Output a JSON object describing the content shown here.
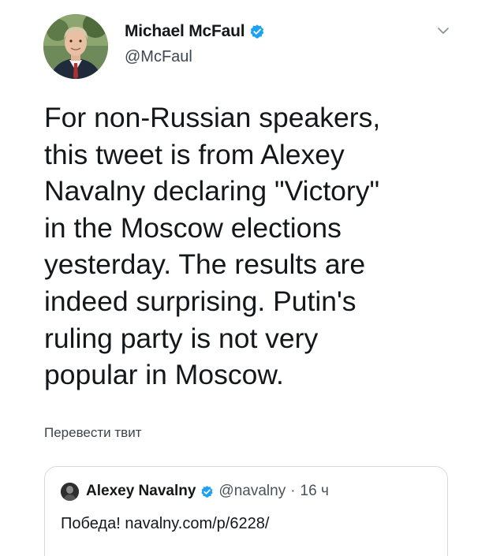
{
  "tweet": {
    "author": {
      "name": "Michael McFaul",
      "handle": "@McFaul",
      "verified": true
    },
    "text_lines": [
      "For non-Russian speakers,",
      "this tweet is from Alexey",
      "Navalny declaring \"Victory\"",
      "in the Moscow elections",
      "yesterday. The results are",
      "indeed surprising. Putin's",
      "ruling party is not very",
      "popular in Moscow."
    ],
    "translate_label": "Перевести твит"
  },
  "quoted": {
    "name": "Alexey Navalny",
    "handle": "@navalny",
    "separator": "·",
    "time": "16 ч",
    "text": "Победа! navalny.com/p/6228/"
  },
  "colors": {
    "verified_blue": "#1da1f2",
    "text_primary": "#14171a",
    "text_secondary": "#3d4650",
    "card_border": "#d4dbe1"
  }
}
